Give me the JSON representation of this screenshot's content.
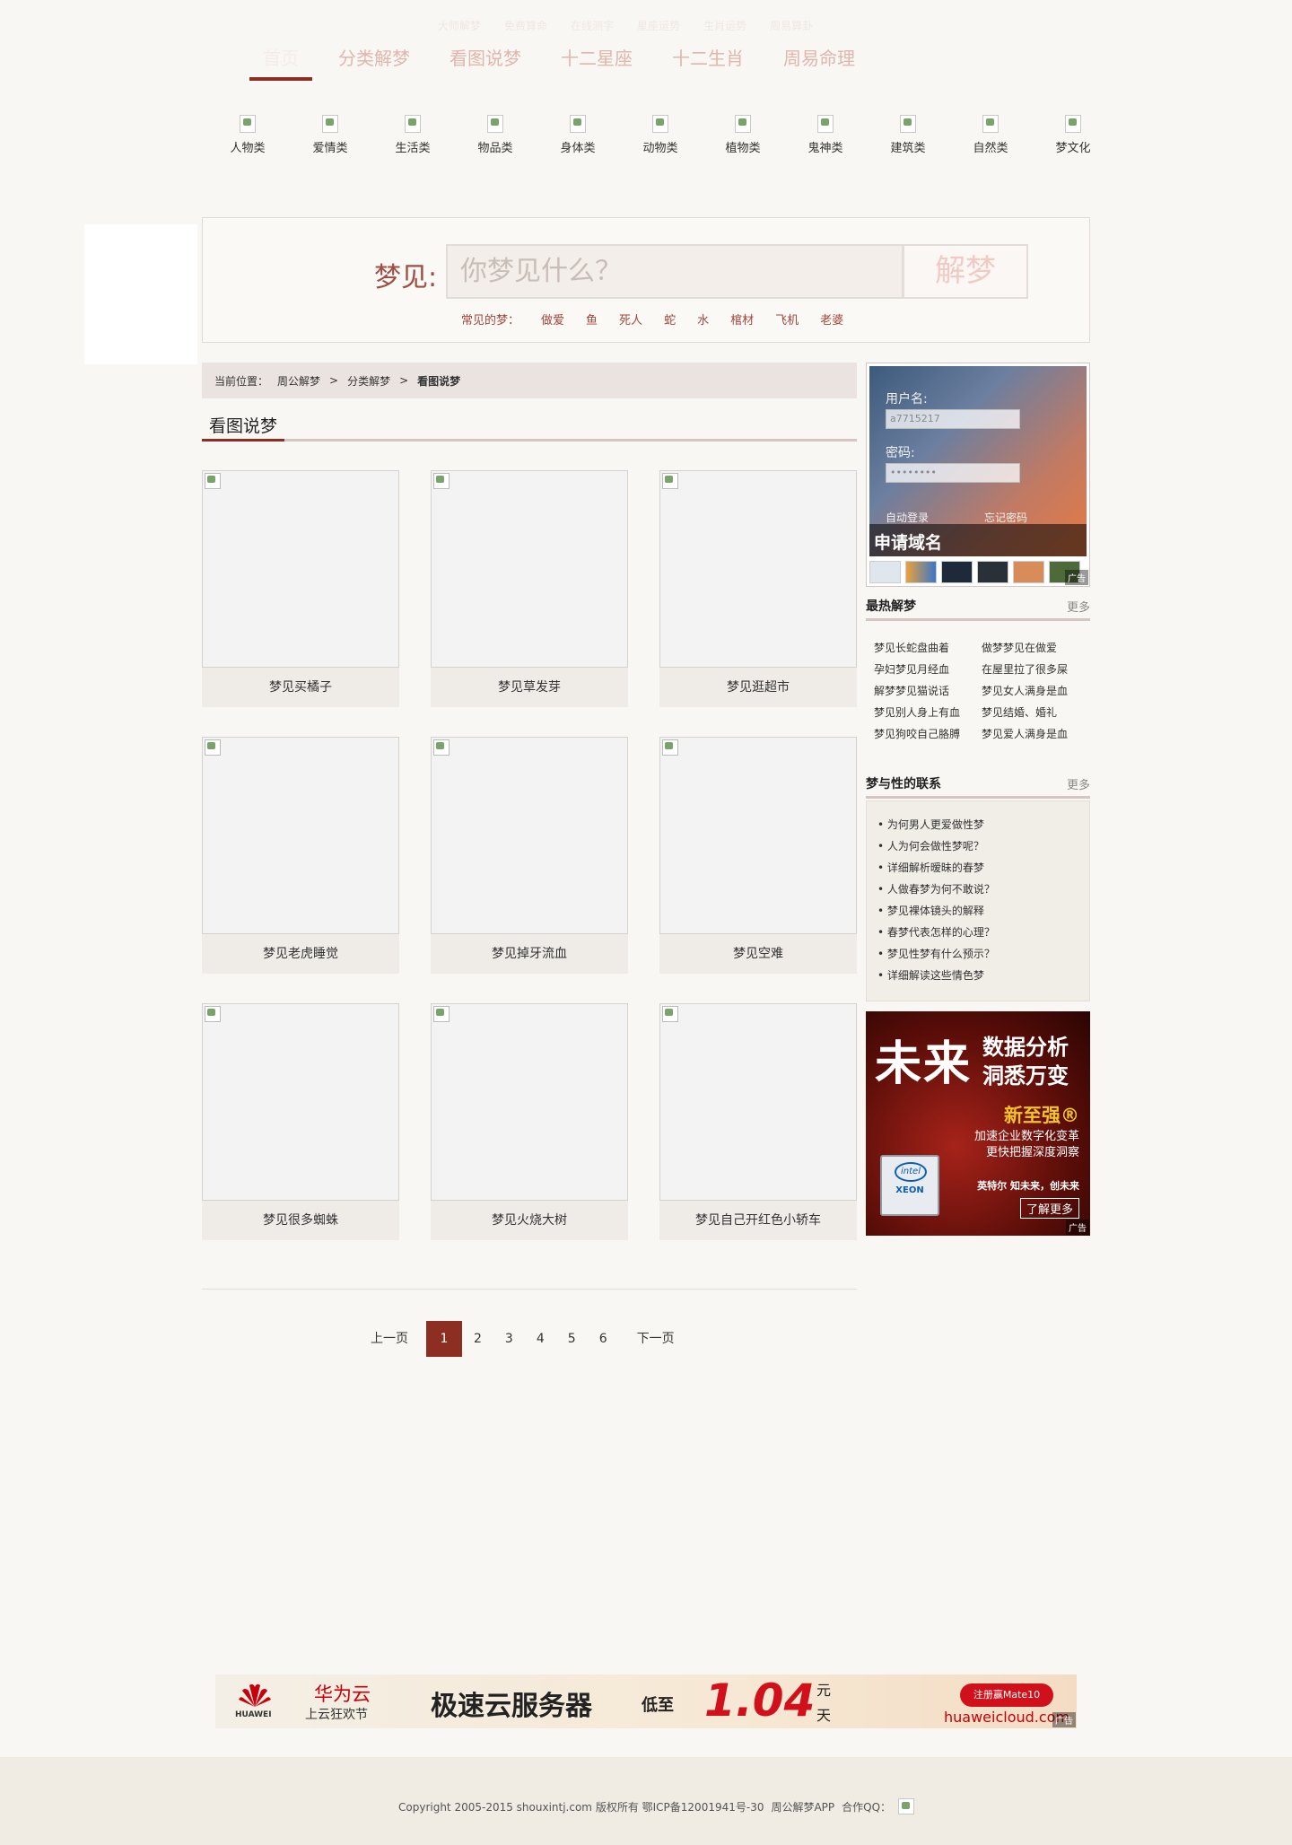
{
  "top_links": [
    "大师解梦",
    "免费算命",
    "在线测字",
    "星座运势",
    "生肖运势",
    "周易算卦"
  ],
  "main_nav": [
    {
      "label": "首页",
      "active": true
    },
    {
      "label": "分类解梦",
      "active": false
    },
    {
      "label": "看图说梦",
      "active": false
    },
    {
      "label": "十二星座",
      "active": false
    },
    {
      "label": "十二生肖",
      "active": false
    },
    {
      "label": "周易命理",
      "active": false
    }
  ],
  "categories": [
    "人物类",
    "爱情类",
    "生活类",
    "物品类",
    "身体类",
    "动物类",
    "植物类",
    "鬼神类",
    "建筑类",
    "自然类",
    "梦文化"
  ],
  "search": {
    "label": "梦见:",
    "placeholder": "你梦见什么？",
    "button": "解梦",
    "hot_label": "常见的梦：",
    "hot_words": [
      "做爱",
      "鱼",
      "死人",
      "蛇",
      "水",
      "棺材",
      "飞机",
      "老婆"
    ]
  },
  "breadcrumb": {
    "prefix": "当前位置：",
    "items": [
      "周公解梦",
      "分类解梦",
      "看图说梦"
    ],
    "sep": ">"
  },
  "section_title": "看图说梦",
  "cards": [
    "梦见买橘子",
    "梦见草发芽",
    "梦见逛超市",
    "梦见老虎睡觉",
    "梦见掉牙流血",
    "梦见空难",
    "梦见很多蜘蛛",
    "梦见火烧大树",
    "梦见自己开红色小轿车"
  ],
  "pager": {
    "prev": "上一页",
    "pages": [
      "1",
      "2",
      "3",
      "4",
      "5",
      "6"
    ],
    "current": "1",
    "next": "下一页"
  },
  "login_ad": {
    "user_label": "用户名:",
    "user_value": "a7715217",
    "pass_label": "密码:",
    "pass_value": "••••••••",
    "remember": "自动登录",
    "forgot": "忘记密码",
    "caption": "申请域名",
    "tag": "广告"
  },
  "hot_dreams": {
    "title": "最热解梦",
    "more": "更多",
    "items": [
      "梦见长蛇盘曲着",
      "做梦梦见在做爱",
      "孕妇梦见月经血",
      "在屋里拉了很多屎",
      "解梦梦见猫说话",
      "梦见女人满身是血",
      "梦见别人身上有血",
      "梦见结婚、婚礼",
      "梦见狗咬自己胳膊",
      "梦见爱人满身是血"
    ]
  },
  "sex_dreams": {
    "title": "梦与性的联系",
    "more": "更多",
    "items": [
      "为何男人更爱做性梦",
      "人为何会做性梦呢？",
      "详细解析暧昧的春梦",
      "人做春梦为何不敢说？",
      "梦见裸体镜头的解释",
      "春梦代表怎样的心理？",
      "梦见性梦有什么预示？",
      "详细解读这些情色梦"
    ]
  },
  "intel_ad": {
    "big": "未来",
    "line1": "数据分析",
    "line2": "洞悉万变",
    "new": "新至强®",
    "sub1": "加速企业数字化变革",
    "sub2": "更快把握深度洞察",
    "chip_logo": "intel",
    "chip_text": "XEON",
    "slogan": "英特尔  知未来，创未来",
    "more": "了解更多",
    "tag": "广告"
  },
  "huawei_ad": {
    "brand": "HUAWEI",
    "name": "华为云",
    "event": "上云狂欢节",
    "headline": "极速云服务器",
    "low": "低至",
    "price": "1.04",
    "unit1": "元",
    "unit2": "天",
    "cta": "注册赢Mate10",
    "url": "huaweicloud.com",
    "tag": "广告"
  },
  "footer": {
    "copyright": "Copyright 2005-2015 shouxintj.com 版权所有 鄂ICP备12001941号-30",
    "app": "周公解梦APP",
    "coop": "合作QQ："
  },
  "colors": {
    "accent": "#8c2e22",
    "page_bg": "#f9f7f3",
    "footer_bg": "#f0ebe3"
  }
}
